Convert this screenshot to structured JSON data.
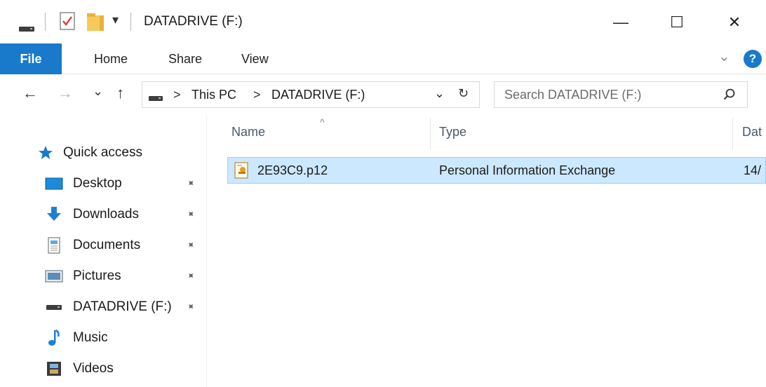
{
  "window": {
    "title": "DATADRIVE (F:)",
    "minimize_glyph": "—",
    "maximize_glyph": "☐",
    "close_glyph": "✕"
  },
  "quick_access_toolbar": {
    "icons": [
      "drive-icon",
      "properties-checkmark-icon",
      "new-folder-icon",
      "customize-dropdown-icon"
    ],
    "dropdown_glyph": "▾"
  },
  "ribbon": {
    "tabs": [
      {
        "label": "File",
        "active": true
      },
      {
        "label": "Home"
      },
      {
        "label": "Share"
      },
      {
        "label": "View"
      }
    ],
    "expand_glyph": "⌄",
    "help_glyph": "?",
    "accent_color": "#1979ca"
  },
  "navigation": {
    "back_glyph": "←",
    "forward_glyph": "→",
    "recent_glyph": "⌄",
    "up_glyph": "↑",
    "address": {
      "breadcrumbs": [
        "This PC",
        "DATADRIVE (F:)"
      ],
      "separator": ">",
      "dropdown_glyph": "⌄",
      "refresh_glyph": "↻"
    },
    "search": {
      "placeholder": "Search DATADRIVE (F:)",
      "icon": "search-icon",
      "glyph": "⚲"
    }
  },
  "sidebar": {
    "quick_access_label": "Quick access",
    "pin_glyph": "📌",
    "items": [
      {
        "label": "Desktop",
        "icon": "desktop-icon",
        "pinned": true
      },
      {
        "label": "Downloads",
        "icon": "downloads-icon",
        "pinned": true
      },
      {
        "label": "Documents",
        "icon": "documents-icon",
        "pinned": true
      },
      {
        "label": "Pictures",
        "icon": "pictures-icon",
        "pinned": true
      },
      {
        "label": "DATADRIVE (F:)",
        "icon": "drive-icon",
        "pinned": true
      },
      {
        "label": "Music",
        "icon": "music-icon",
        "pinned": false
      },
      {
        "label": "Videos",
        "icon": "videos-icon",
        "pinned": false
      }
    ]
  },
  "file_list": {
    "columns": [
      {
        "label": "Name"
      },
      {
        "label": "Type"
      },
      {
        "label": "Dat"
      }
    ],
    "sort_glyph": "^",
    "rows": [
      {
        "name": "2E93C9.p12",
        "type": "Personal Information Exchange",
        "date": "14/",
        "icon": "certificate-file-icon",
        "selected": true
      }
    ],
    "selection_color": "#cce8ff"
  }
}
